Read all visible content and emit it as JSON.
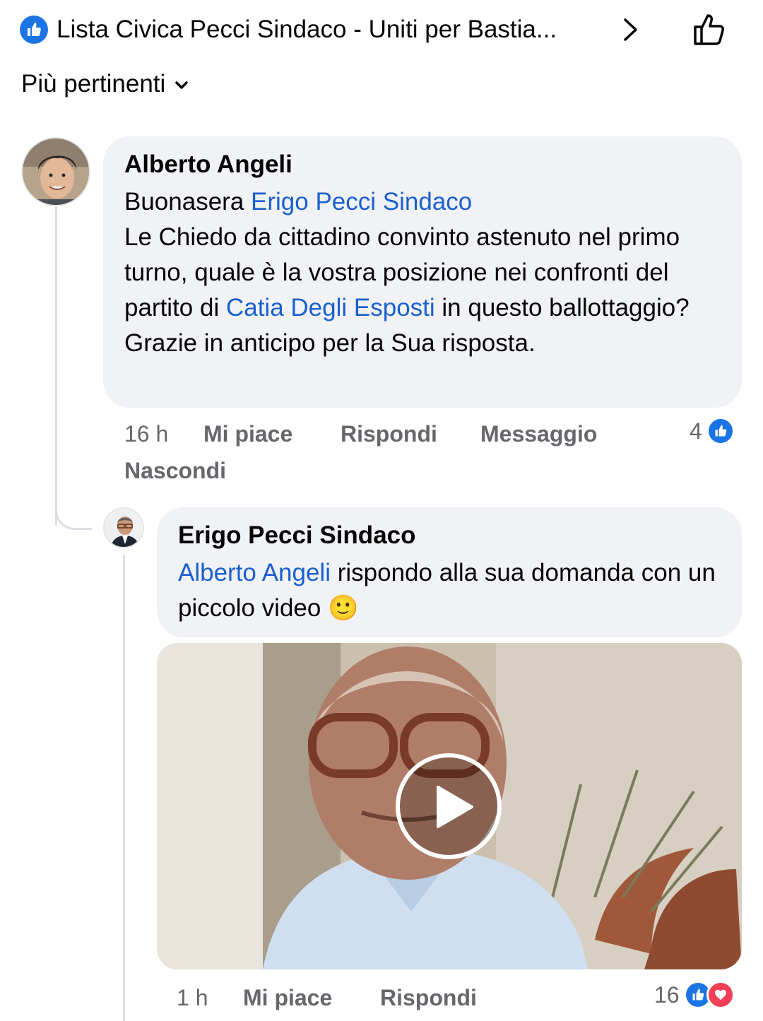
{
  "header": {
    "page_name": "Lista Civica Pecci Sindaco - Uniti per Bastia...",
    "icons": {
      "page": "like-badge-icon",
      "next": "chevron-right-icon",
      "like_page": "thumbs-up-outline-icon"
    }
  },
  "sort": {
    "label": "Più pertinenti",
    "icon": "chevron-down-icon"
  },
  "comments": [
    {
      "author": "Alberto Angeli",
      "text": {
        "greeting": "Buonasera ",
        "mention1": "Erigo Pecci Sindaco",
        "body1": "Le Chiedo da cittadino convinto astenuto nel primo turno, quale è la vostra posizione nei confronti del partito di ",
        "mention2": "Catia Degli Esposti",
        "body2": " in questo ballottaggio?",
        "closing": "Grazie in anticipo per la Sua risposta."
      },
      "time": "16 h",
      "actions": {
        "like": "Mi piace",
        "reply": "Rispondi",
        "message": "Messaggio",
        "hide": "Nascondi"
      },
      "reactions": {
        "count": "4",
        "types": [
          "like"
        ]
      }
    },
    {
      "author": "Erigo Pecci Sindaco",
      "text": {
        "mention": "Alberto Angeli",
        "body": " rispondo alla sua domanda con un piccolo video ",
        "emoji": "🙂"
      },
      "attachment": {
        "type": "video",
        "icon": "play-icon"
      },
      "time": "1 h",
      "actions": {
        "like": "Mi piace",
        "reply": "Rispondi"
      },
      "reactions": {
        "count": "16",
        "types": [
          "like",
          "love"
        ]
      }
    }
  ],
  "colors": {
    "link": "#1b5fcf",
    "bubble": "#f0f2f5",
    "like": "#1b74e4",
    "love": "#f33e58",
    "meta": "#65676b"
  }
}
